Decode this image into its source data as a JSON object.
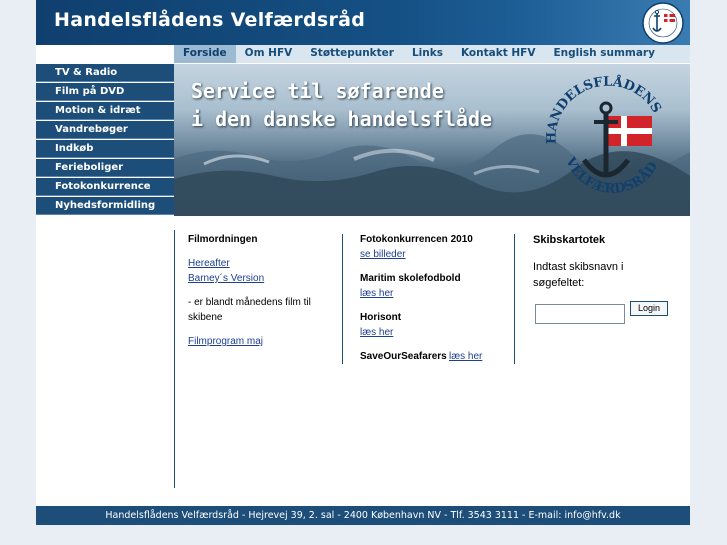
{
  "header": {
    "title": "Handelsflådens Velfærdsråd",
    "logo_icon": "hfv-seal-icon"
  },
  "topnav": {
    "items": [
      {
        "label": "Forside",
        "active": true
      },
      {
        "label": "Om HFV"
      },
      {
        "label": "Støttepunkter"
      },
      {
        "label": "Links"
      },
      {
        "label": "Kontakt HFV"
      },
      {
        "label": "English summary"
      }
    ]
  },
  "sidebar": {
    "items": [
      {
        "label": "TV & Radio"
      },
      {
        "label": "Film på DVD"
      },
      {
        "label": "Motion & idræt"
      },
      {
        "label": "Vandrebøger"
      },
      {
        "label": "Indkøb"
      },
      {
        "label": "Ferieboliger"
      },
      {
        "label": "Fotokonkurrence"
      },
      {
        "label": "Nyhedsformidling"
      }
    ]
  },
  "banner": {
    "line1": "Service til søfarende",
    "line2": "i den danske handelsflåde",
    "emblem_text_top": "HANDELSFLÅDENS",
    "emblem_text_bottom": "VELFÆRDSRÅD"
  },
  "film": {
    "heading": "Filmordningen",
    "link1": "Hereafter",
    "link2": "Barney´s Version",
    "text": "- er blandt månedens film til skibene",
    "program_link": "Filmprogram maj"
  },
  "news": {
    "foto_heading": "Fotokonkurrencen 2010",
    "foto_link": "se billeder",
    "maritim_heading": "Maritim skolefodbold",
    "maritim_link": "læs her",
    "horisont_heading": "Horisont",
    "horisont_link": "læs her",
    "sos_heading": "SaveOurSeafarers",
    "sos_link": "læs her"
  },
  "skibs": {
    "heading": "Skibskartotek",
    "text": "Indtast skibsnavn i søgefeltet:",
    "input_value": "",
    "login_label": "Login"
  },
  "footer": {
    "text": "Handelsflådens Velfærdsråd  -  Hejrevej 39, 2. sal  -  2400 København NV  -  Tlf. 3543 3111  -  E-mail: info@hfv.dk"
  },
  "colors": {
    "brand_dark": "#1d4e79",
    "header_dark": "#0f3f6e",
    "nav_bg": "#d9e5ef",
    "nav_active": "#9cbbd2",
    "flag_red": "#d2232a"
  }
}
